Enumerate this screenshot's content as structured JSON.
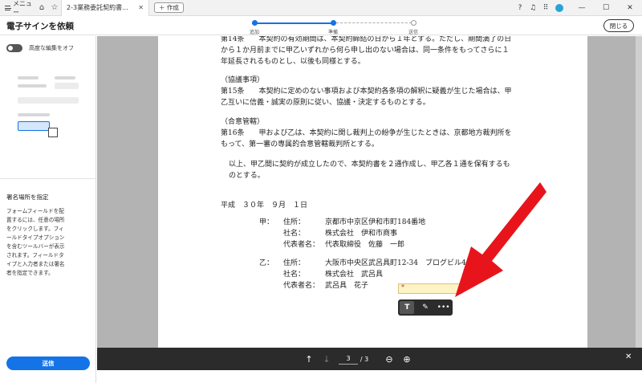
{
  "titlebar": {
    "menu_label": "メニュー",
    "tab_title": "2-3業務委託契約書...",
    "create_label": "作成"
  },
  "header": {
    "title": "電子サインを依頼",
    "close_label": "閉じる",
    "steps": [
      {
        "label": "追加",
        "state": "done"
      },
      {
        "label": "準備",
        "state": "current"
      },
      {
        "label": "送信",
        "state": "todo"
      }
    ]
  },
  "sidebar": {
    "toggle_label": "高度な編集をオフ",
    "toggle_on": false,
    "heading": "署名場所を指定",
    "description": [
      "フォームフィールドを配",
      "置するには、任意の場所",
      "をクリックします。フィ",
      "ールドタイプオプション",
      "を含むツールバーが表示",
      "されます。フィールドタ",
      "イプと入力者または署名",
      "者を指定できます。"
    ],
    "send_label": "送信"
  },
  "document": {
    "lines": [
      "第14条　　本契約の有効期間は、本契約締結の日から１年とする。ただし、期間満了の日",
      "から１か月前までに甲乙いずれから何ら申し出のない場合は、同一条件をもってさらに１",
      "年延長されるものとし、以後も同様とする。",
      "（協議事項）",
      "第15条　　本契約に定めのない事項および本契約各条項の解釈に疑義が生じた場合は、甲",
      "乙互いに信義・誠実の原則に従い、協議・決定するものとする。",
      "（合意管轄）",
      "第16条　　甲および乙は、本契約に関し裁判上の紛争が生じたときは、京都地方裁判所を",
      "もって、第一審の専属的合意管轄裁判所とする。",
      "以上、甲乙間に契約が成立したので、本契約書を２通作成し、甲乙各１通を保有するも",
      "のとする。",
      "平成　３０年　９月　１日"
    ],
    "party_a": {
      "label": "甲：",
      "address_label": "住所：",
      "address": "京都市中京区伊和市町184番地",
      "company_label": "社名：",
      "company": "株式会社　伊和市商事",
      "rep_label": "代表者名：",
      "rep": "代表取締役　佐藤　一郎"
    },
    "party_b": {
      "label": "乙：",
      "address_label": "住所：",
      "address": "大阪市中央区武呂具町12-34　ブログビル4",
      "company_label": "社名：",
      "company": "株式会社　武呂具",
      "rep_label": "代表者名：",
      "rep": "武呂具　花子"
    },
    "required_mark": "*"
  },
  "field_toolbar": {
    "text_tool": "T",
    "sign_tool": "✎",
    "more": "•••"
  },
  "pager": {
    "current": "3",
    "total": "/ 3"
  },
  "colors": {
    "accent": "#1473e6",
    "arrow": "#e8141c",
    "field_bg": "#fdf3c4"
  }
}
